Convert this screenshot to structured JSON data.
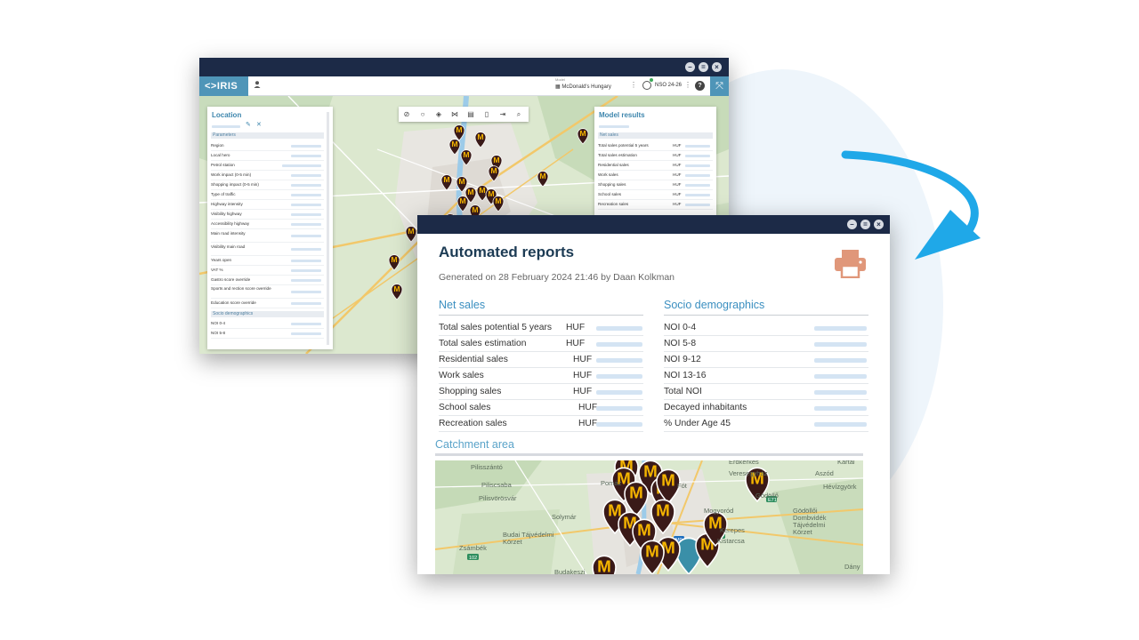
{
  "back_window": {
    "logo": "<>IRIS",
    "model_caption": "Model",
    "model_value": "McDonald's Hungary",
    "nso_label": "NSO 24-26",
    "location_panel": {
      "title": "Location",
      "section_parameters": "Parameters",
      "items": [
        "Region",
        "Local hero",
        "Petrol station",
        "Work impact (0-5 min)",
        "Shopping impact (0-5 min)",
        "Type of traffic",
        "Highway intensity",
        "Visibility highway",
        "Accessibility highway",
        "Main road intensity",
        "Visibility main road",
        "Years open",
        "VAT %",
        "Gastro score override",
        "Sports and rection score override",
        "Education score override"
      ],
      "section_socio": "Socio demographics",
      "socio_items": [
        "NOI 0-4",
        "NOI 5-8"
      ]
    },
    "results_panel": {
      "title": "Model results",
      "section": "Net sales",
      "unit": "HUF",
      "items": [
        "Total sales potential 5 years",
        "Total sales estimation",
        "Residential sales",
        "Work sales",
        "Shopping sales",
        "School sales",
        "Recreation sales"
      ]
    }
  },
  "report": {
    "title": "Automated reports",
    "generated": "Generated on 28 February 2024 21:46 by Daan Kolkman",
    "net_sales": {
      "heading": "Net sales",
      "unit": "HUF",
      "rows": [
        "Total sales potential 5 years",
        "Total sales estimation",
        "Residential sales",
        "Work sales",
        "Shopping sales",
        "School sales",
        "Recreation sales"
      ]
    },
    "socio": {
      "heading": "Socio demographics",
      "rows": [
        "NOI 0-4",
        "NOI 5-8",
        "NOI 9-12",
        "NOI 13-16",
        "Total NOI",
        "Decayed inhabitants",
        "% Under Age 45"
      ]
    },
    "catchment": {
      "heading": "Catchment area",
      "places": [
        "Érdkerkes",
        "Kartal",
        "Pilisszántó",
        "Veresegyház",
        "Aszód",
        "Piliscsaba",
        "Pomáz",
        "Fót",
        "Gödöllő",
        "Hévízgyörk",
        "Pilisvörösvár",
        "Mogyoród",
        "Solymár",
        "Gödöllői Dombvidék Tájvédelmi Körzet",
        "Kerepes",
        "Budai Tájvédelmi Körzet",
        "Kistarcsa",
        "Zsámbék",
        "Dány",
        "Budakeszi"
      ]
    }
  },
  "colors": {
    "navy": "#1c2a47",
    "accent": "#3b8fc0",
    "marker": "#3a1a18",
    "mc_yellow": "#f4b400",
    "printer": "#e0977a",
    "arrow": "#1fa8e8"
  }
}
